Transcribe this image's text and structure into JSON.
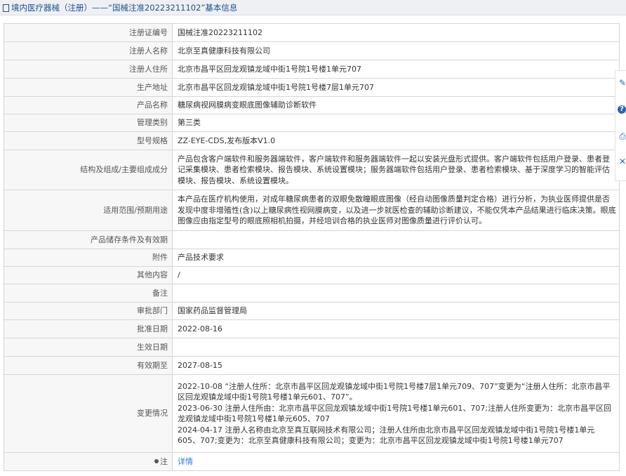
{
  "header": {
    "breadcrumb": "境内医疗器械（注册）——“国械注准20223211102”基本信息"
  },
  "rows": [
    {
      "label": "注册证编号",
      "value": "国械注准20223211102"
    },
    {
      "label": "注册人名称",
      "value": "北京至真健康科技有限公司"
    },
    {
      "label": "注册人住所",
      "value": "北京市昌平区回龙观镇龙域中街1号院1号楼1单元707"
    },
    {
      "label": "生产地址",
      "value": "北京市昌平区回龙观镇龙域中街1号院1号楼7层1单元707"
    },
    {
      "label": "产品名称",
      "value": "糖尿病视网膜病变眼底图像辅助诊断软件"
    },
    {
      "label": "管理类别",
      "value": "第三类"
    },
    {
      "label": "型号规格",
      "value": "ZZ-EYE-CDS,发布版本V1.0"
    },
    {
      "label": "结构及组成/主要组成成分",
      "value": "产品包含客户端软件和服务器端软件，客户端软件和服务器端软件一起以安装光盘形式提供。客户端软件包括用户登录、患者登记采集模块、患者检索模块、报告模块、系统设置模块；服务器端软件包括用户登录、患者检索模块、基于深度学习的智能评估模块、报告模块、系统设置模块。"
    },
    {
      "label": "适用范围/预期用途",
      "value": "本产品在医疗机构使用，对成年糖尿病患者的双眼免散瞳眼底图像（经自动图像质量判定合格）进行分析，为执业医师提供是否发现中度非增殖性(含)以上糖尿病性视网膜病变，以及进一步就医检查的辅助诊断建议，不能仅凭本产品结果进行临床决策。眼底图像应由指定型号的眼底照相机拍摄，并经培训合格的执业医师对图像质量进行评价认可。"
    },
    {
      "label": "产品储存条件及有效期",
      "value": ""
    },
    {
      "label": "附件",
      "value": "产品技术要求"
    },
    {
      "label": "其他内容",
      "value": "/"
    },
    {
      "label": "备注",
      "value": ""
    },
    {
      "label": "审批部门",
      "value": "国家药品监督管理局"
    },
    {
      "label": "批准日期",
      "value": "2022-08-16"
    },
    {
      "label": "生效日期",
      "value": ""
    },
    {
      "label": "有效期至",
      "value": "2027-08-15"
    }
  ],
  "changes": {
    "label": "变更情况",
    "entries": [
      "2022-10-08 “注册人住所：北京市昌平区回龙观镇龙域中街1号院1号楼7层1单元709、707”变更为“注册人住所：北京市昌平区回龙观镇龙域中街1号院1号楼1单元601、707”。",
      "2023-06-30 注册人住所由：北京市昌平区回龙观镇龙域中街1号院1号楼1单元601、707;注册人住所变更为：北京市昌平区回龙观镇龙域中街1号院1号楼1单元605、707",
      "2024-04-17 注册人名称由北京至真互联网技术有限公司；注册人住所由北京市昌平区回龙观镇龙域中街1号院1号楼1单元605、707;变更为：北京至真健康科技有限公司；变更为：北京市昌平区回龙观镇龙域中街1号院1号楼1单元707"
    ]
  },
  "note": {
    "label": "注",
    "link": "详情"
  },
  "side_tools": [
    "edit-icon",
    "help-icon",
    "print-icon",
    "close-icon"
  ],
  "colors": {
    "accent": "#1d4f91",
    "link": "#2a7ae2",
    "label_bg": "#f7f7f7",
    "border": "#d6d6d6"
  }
}
